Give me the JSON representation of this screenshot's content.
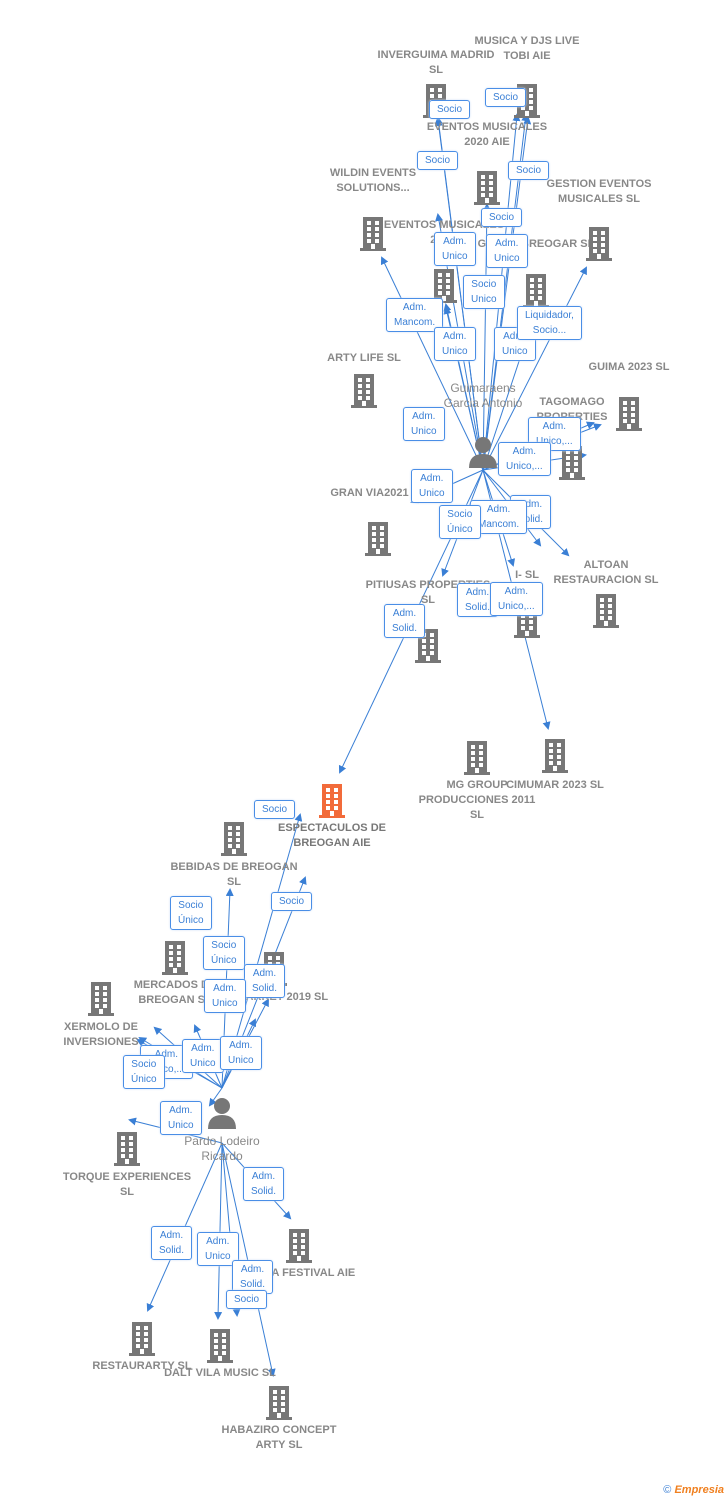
{
  "colors": {
    "company": "#777777",
    "focus_company": "#f26b3a",
    "edge": "#3a7fd5"
  },
  "persons": [
    {
      "name": "Guimaraens Garcia Antonio",
      "icon": "person-icon"
    },
    {
      "name": "Pardo Lodeiro Ricardo",
      "icon": "person-icon"
    }
  ],
  "companies": [
    "INVERGUIMA MADRID  SL",
    "MUSICA Y DJS LIVE TOBI AIE",
    "EVENTOS MUSICALES 2020 AIE",
    "WILDIN EVENTS SOLUTIONS...",
    "EVENTOS MUSICALES 202...",
    "GRUPO BREOGAR SL",
    "GESTION EVENTOS MUSICALES SL",
    "ARTY LIFE  SL",
    "GUIMA 2023 SL",
    "TAGOMAGO PROPERTIES",
    "GRAN VIA2021  SL",
    "ALTOAN RESTAURACION SL",
    "PITIUSAS PROPERTIES SL",
    "I- SL",
    "MG GROUP PRODUCCIONES 2011 SL",
    "CIMUMAR 2023  SL",
    "ESPECTACULOS DE BREOGAN AIE",
    "BEBIDAS DE BREOGAN  SL",
    "MERCADOS DE BREOGAN  SL",
    "XERMOLO DE INVERSIONES",
    "...EMARKET 2019  SL",
    "TORQUE EXPERIENCES SL",
    "BELLA FESTIVAL  AIE",
    "RESTAURARTY SL",
    "DALT VILA MUSIC  SL",
    "HABAZIRO CONCEPT ARTY  SL"
  ],
  "edge_labels": [
    "Socio",
    "Socio",
    "Socio",
    "Socio",
    "Socio",
    "Adm.\nUnico",
    "Adm.\nUnico",
    "Socio\nUnico",
    "Adm.\nMancom.",
    "Adm.\nUnico",
    "Adm.\nUnico",
    "Liquidador,\nSocio...",
    "Adm.\nUnico",
    "Adm.\nUnico,...",
    "Adm.\nUnico,...",
    "Adm.\nUnico",
    "Adm.\nSolid.",
    "Adm.\nMancom.",
    "Socio\nÚnico",
    "Adm.\nSolid.",
    "Adm.\nUnico,...",
    "Adm.\nSolid.",
    "Socio",
    "Socio",
    "Socio\nÚnico",
    "Socio\nÚnico",
    "Adm.\nSolid.",
    "Adm.\nUnico",
    "Adm.\nUnico,...",
    "Adm.\nUnico",
    "Adm.\nUnico",
    "Socio\nÚnico",
    "Adm.\nUnico",
    "Adm.\nSolid.",
    "Adm.\nSolid.",
    "Adm.\nUnico",
    "Adm.\nSolid.",
    "Socio"
  ],
  "watermark": {
    "symbol": "©",
    "brand": "Empresia"
  }
}
